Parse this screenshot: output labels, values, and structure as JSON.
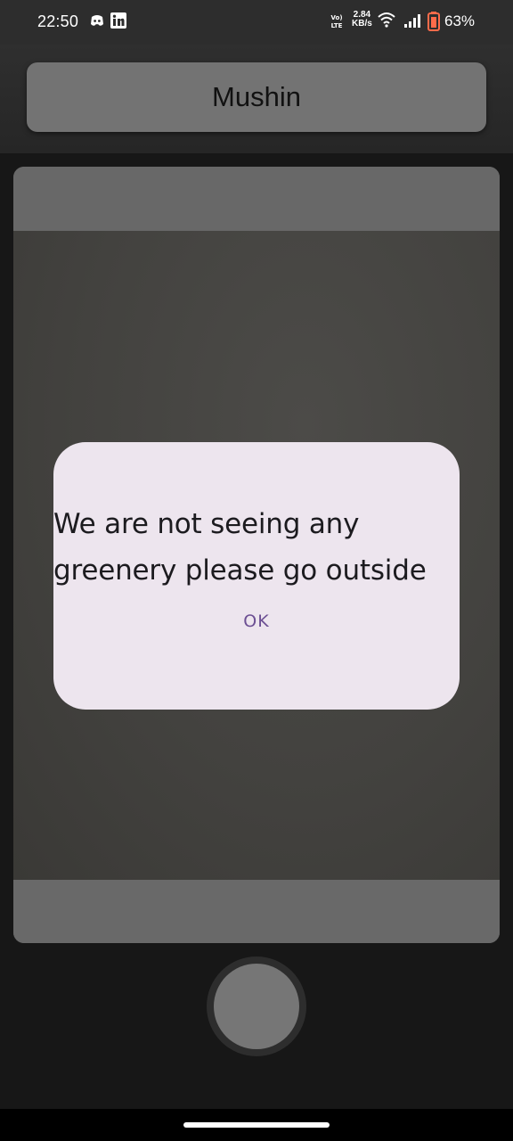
{
  "status_bar": {
    "time": "22:50",
    "notification_icons": [
      "discord-icon",
      "linkedin-icon"
    ],
    "network_speed_value": "2.84",
    "network_speed_unit": "KB/s",
    "volte_label": "VoLTE",
    "battery_percent": "63%",
    "colors": {
      "battery": "#ff6b4a"
    }
  },
  "header": {
    "title": "Mushin"
  },
  "dialog": {
    "message": "We are not seeing any greenery please go outside",
    "ok_label": "OK"
  },
  "colors": {
    "dialog_bg": "#ede5ee",
    "accent": "#6c4f93",
    "background": "#171717"
  }
}
